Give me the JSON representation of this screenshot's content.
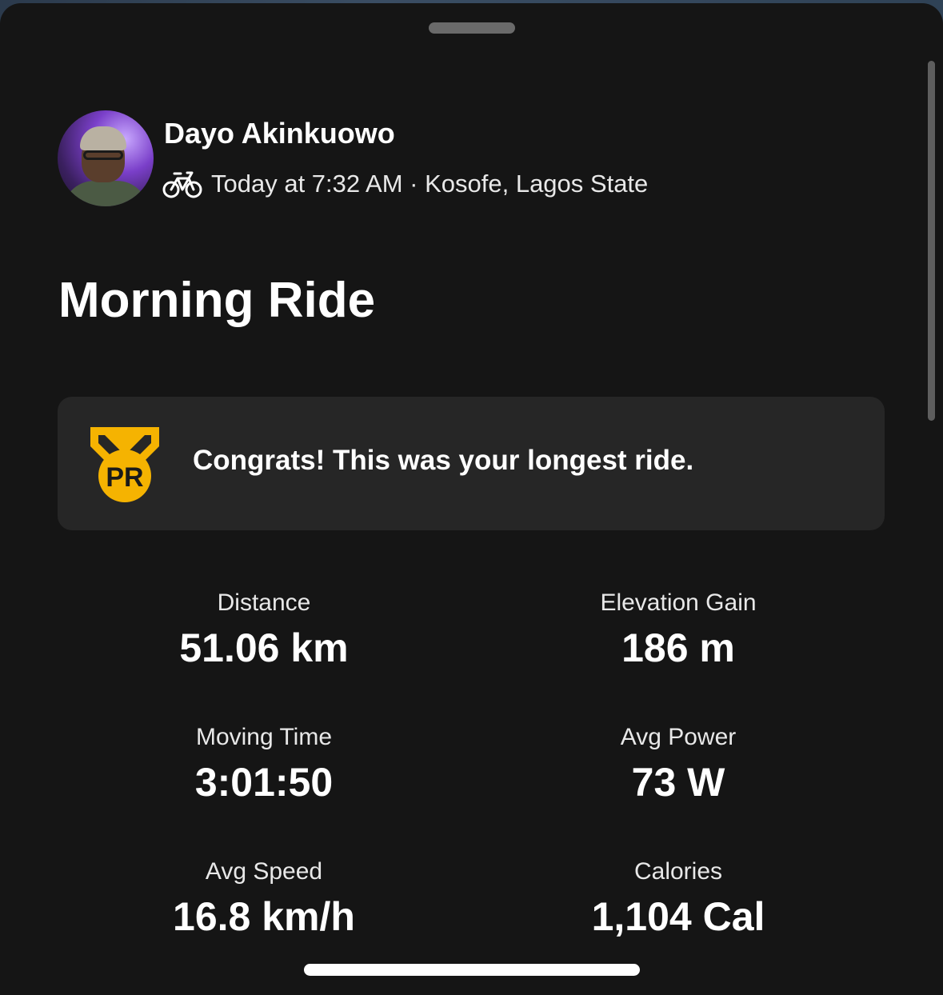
{
  "athlete": {
    "name": "Dayo Akinkuowo",
    "activity_icon": "bike-icon",
    "meta": "Today at 7:32 AM · Kosofe, Lagos State"
  },
  "activity": {
    "title": "Morning Ride"
  },
  "pr_banner": {
    "icon_text": "PR",
    "icon_color": "#F5B301",
    "message": "Congrats! This was your longest ride."
  },
  "stats": [
    {
      "label": "Distance",
      "value": "51.06 km"
    },
    {
      "label": "Elevation Gain",
      "value": "186 m"
    },
    {
      "label": "Moving Time",
      "value": "3:01:50"
    },
    {
      "label": "Avg Power",
      "value": "73 W"
    },
    {
      "label": "Avg Speed",
      "value": "16.8 km/h"
    },
    {
      "label": "Calories",
      "value": "1,104 Cal"
    }
  ]
}
